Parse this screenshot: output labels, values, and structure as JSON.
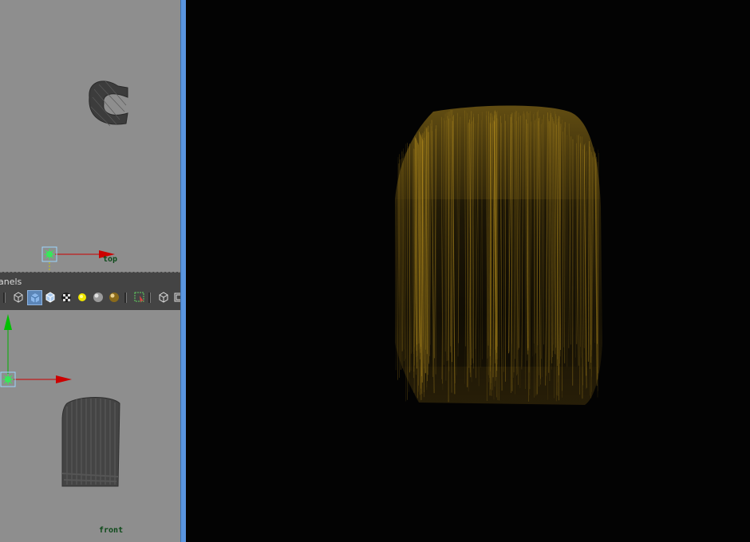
{
  "top_view": {
    "label": "top"
  },
  "front_view": {
    "label": "front"
  },
  "panel_bar": {
    "menu_label": "anels",
    "toolbar": [
      {
        "icon": "wireframe-cube-icon"
      },
      {
        "icon": "smooth-shade-cube-icon"
      },
      {
        "icon": "wireframe-on-shaded-cube-icon"
      },
      {
        "icon": "textured-checker-icon"
      },
      {
        "icon": "default-light-icon"
      },
      {
        "icon": "all-lights-sphere-icon"
      },
      {
        "icon": "shadows-sphere-icon"
      },
      {
        "icon": "isolate-select-icon"
      },
      {
        "icon": "bounding-box-cube-icon"
      },
      {
        "icon": "camera-gate-icon"
      }
    ]
  },
  "colors": {
    "viewport_bg": "#8e8e8e",
    "panel_bar_bg": "#444444",
    "divider": "#5a95df",
    "render_bg": "#030303",
    "hair": "#b08a1e",
    "axis_x": "#cc0000",
    "axis_y": "#00b000"
  }
}
